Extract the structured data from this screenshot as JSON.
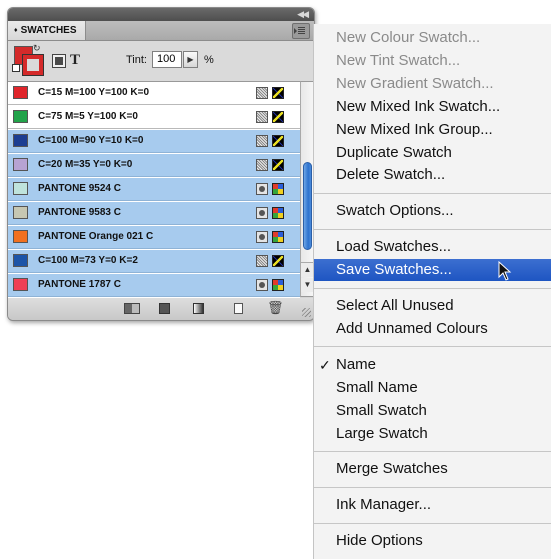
{
  "panel": {
    "tab_label": "SWATCHES",
    "tab_arrows": "♦",
    "tint_label": "Tint:",
    "tint_value": "100",
    "tint_unit": "%",
    "text_toggle": "T",
    "swatches": [
      {
        "name": "C=15 M=100 Y=100 K=0",
        "color": "#e0252b",
        "type": "process",
        "selected": false
      },
      {
        "name": "C=75 M=5 Y=100 K=0",
        "color": "#22a34a",
        "type": "process",
        "selected": false
      },
      {
        "name": "C=100 M=90 Y=10 K=0",
        "color": "#1d3e91",
        "type": "process",
        "selected": true
      },
      {
        "name": "C=20 M=35 Y=0 K=0",
        "color": "#b7a3d3",
        "type": "process",
        "selected": true
      },
      {
        "name": "PANTONE 9524 C",
        "color": "#bfe3dc",
        "type": "spot",
        "selected": true
      },
      {
        "name": "PANTONE 9583 C",
        "color": "#c7c7b2",
        "type": "spot",
        "selected": true
      },
      {
        "name": "PANTONE Orange 021 C",
        "color": "#f2701f",
        "type": "spot",
        "selected": true
      },
      {
        "name": "C=100 M=73 Y=0 K=2",
        "color": "#1c54a7",
        "type": "process",
        "selected": true
      },
      {
        "name": "PANTONE 1787 C",
        "color": "#ef4056",
        "type": "spot",
        "selected": true
      }
    ]
  },
  "menu": {
    "groups": [
      [
        {
          "label": "New Colour Swatch...",
          "enabled": false
        },
        {
          "label": "New Tint Swatch...",
          "enabled": false
        },
        {
          "label": "New Gradient Swatch...",
          "enabled": false
        },
        {
          "label": "New Mixed Ink Swatch...",
          "enabled": true
        },
        {
          "label": "New Mixed Ink Group...",
          "enabled": true
        },
        {
          "label": "Duplicate Swatch",
          "enabled": true
        },
        {
          "label": "Delete Swatch...",
          "enabled": true
        }
      ],
      [
        {
          "label": "Swatch Options...",
          "enabled": true
        }
      ],
      [
        {
          "label": "Load Swatches...",
          "enabled": true
        },
        {
          "label": "Save Swatches...",
          "enabled": true,
          "highlighted": true
        }
      ],
      [
        {
          "label": "Select All Unused",
          "enabled": true
        },
        {
          "label": "Add Unnamed Colours",
          "enabled": true
        }
      ],
      [
        {
          "label": "Name",
          "enabled": true,
          "checked": true
        },
        {
          "label": "Small Name",
          "enabled": true
        },
        {
          "label": "Small Swatch",
          "enabled": true
        },
        {
          "label": "Large Swatch",
          "enabled": true
        }
      ],
      [
        {
          "label": "Merge Swatches",
          "enabled": true
        }
      ],
      [
        {
          "label": "Ink Manager...",
          "enabled": true
        }
      ],
      [
        {
          "label": "Hide Options",
          "enabled": true
        }
      ]
    ],
    "check_glyph": "✓"
  },
  "colors": {
    "selection": "#a7cbee",
    "menu_highlight": "#2a5fcc",
    "fill_swatch": "#d42a2a"
  },
  "icons": {
    "panel_menu": "panel-menu-icon",
    "cursor": "arrow-cursor-icon"
  }
}
